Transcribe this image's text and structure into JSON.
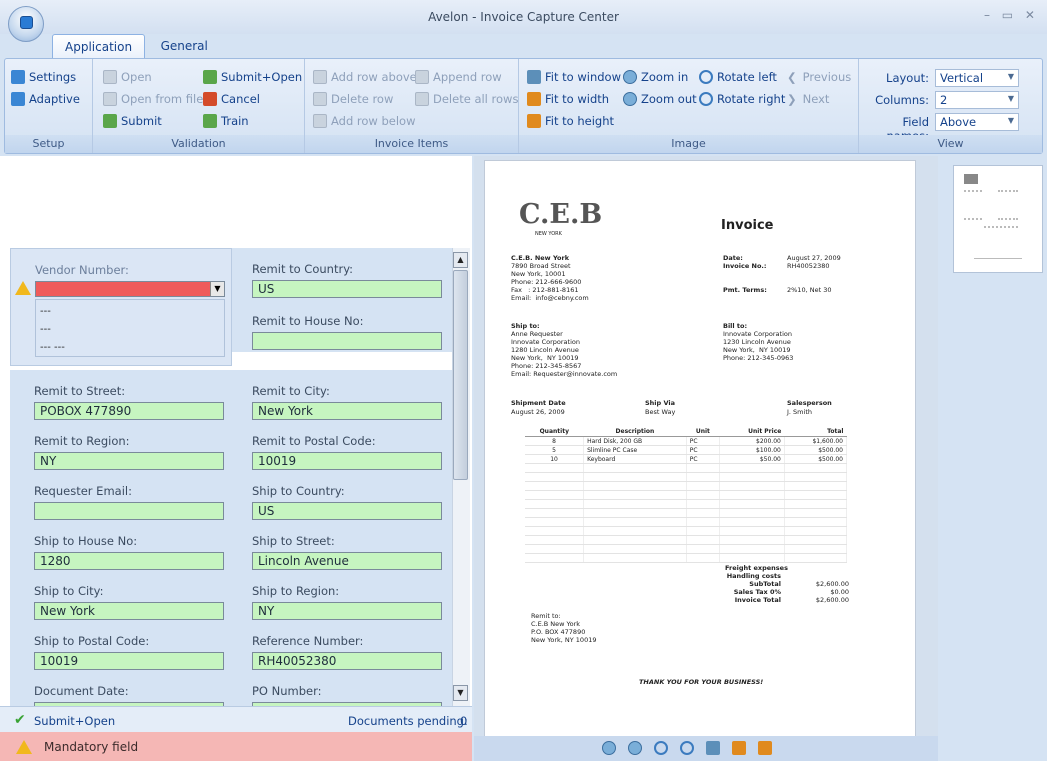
{
  "window": {
    "title": "Avelon - Invoice Capture Center",
    "controls": "– ▭ ✕"
  },
  "tabs": [
    {
      "label": "Application"
    },
    {
      "label": "General"
    }
  ],
  "ribbon": {
    "setup": {
      "label": "Setup",
      "items": [
        "Settings",
        "Adaptive"
      ]
    },
    "validation": {
      "label": "Validation",
      "items": [
        "Open",
        "Open from file",
        "Submit",
        "Submit+Open",
        "Cancel",
        "Train"
      ]
    },
    "invoice_items": {
      "label": "Invoice Items",
      "items": [
        "Add row above",
        "Delete row",
        "Add row below",
        "Append row",
        "Delete all rows"
      ]
    },
    "image": {
      "label": "Image",
      "items": [
        "Fit to window",
        "Fit to width",
        "Fit to height",
        "Zoom in",
        "Zoom out",
        "Rotate left",
        "Rotate right",
        "Previous",
        "Next"
      ]
    },
    "view": {
      "label": "View",
      "layout_label": "Layout:",
      "layout_value": "Vertical",
      "columns_label": "Columns:",
      "columns_value": "2",
      "fieldnames_label": "Field names:",
      "fieldnames_value": "Above"
    }
  },
  "vendor": {
    "label": "Vendor Number:",
    "options": [
      "---",
      "---",
      "--- ---"
    ]
  },
  "fields": [
    {
      "label": "Remit to Country:",
      "value": "US"
    },
    {
      "label": "Remit to House No:",
      "value": ""
    },
    {
      "label": "Remit to Street:",
      "value": "POBOX 477890"
    },
    {
      "label": "Remit to City:",
      "value": "New York"
    },
    {
      "label": "Remit to Region:",
      "value": "NY"
    },
    {
      "label": "Remit to Postal Code:",
      "value": "10019"
    },
    {
      "label": "Requester Email:",
      "value": ""
    },
    {
      "label": "Ship to Country:",
      "value": "US"
    },
    {
      "label": "Ship to House No:",
      "value": "1280"
    },
    {
      "label": "Ship to Street:",
      "value": "Lincoln Avenue"
    },
    {
      "label": "Ship to City:",
      "value": "New York"
    },
    {
      "label": "Ship to Region:",
      "value": "NY"
    },
    {
      "label": "Ship to Postal Code:",
      "value": "10019"
    },
    {
      "label": "Reference Number:",
      "value": "RH40052380"
    },
    {
      "label": "Document Date:",
      "value": "Aug 27, 2009"
    },
    {
      "label": "PO Number:",
      "value": ""
    }
  ],
  "status": {
    "submit_open": "Submit+Open",
    "pending_label": "Documents pending:",
    "pending_count": "0",
    "mandatory": "Mandatory field"
  },
  "invoice": {
    "logo": "C.E.B",
    "logo_sub": "NEW YORK",
    "heading": "Invoice",
    "company": [
      "C.E.B. New York",
      "7890 Broad Street",
      "New York, 10001",
      "Phone: 212-666-9600",
      "Fax   : 212-881-8161",
      "Email:  info@cebny.com"
    ],
    "meta_labels": [
      "Date:",
      "Invoice No.:",
      "",
      "",
      "Pmt. Terms:"
    ],
    "meta_values": [
      "August 27, 2009",
      "RH40052380",
      "",
      "",
      "2%10, Net 30"
    ],
    "ship_to": [
      "Ship to:",
      "Anne Requester",
      "Innovate Corporation",
      "1280 Lincoln Avenue",
      "New York,  NY 10019",
      "Phone: 212-345-8567",
      "Email: Requester@innovate.com"
    ],
    "bill_to": [
      "Bill to:",
      "Innovate Corporation",
      "1230 Lincoln Avenue",
      "New York,  NY 10019",
      "Phone: 212-345-0963"
    ],
    "ship_headers": [
      "Shipment Date",
      "Ship Via",
      "Salesperson"
    ],
    "ship_values": [
      "August 26, 2009",
      "Best Way",
      "J. Smith"
    ],
    "item_headers": [
      "Quantity",
      "Description",
      "Unit",
      "Unit Price",
      "Total"
    ],
    "items": [
      [
        "8",
        "Hard Disk, 200 GB",
        "PC",
        "$200.00",
        "$1,600.00"
      ],
      [
        "5",
        "Slimline PC Case",
        "PC",
        "$100.00",
        "$500.00"
      ],
      [
        "10",
        "Keyboard",
        "PC",
        "$50.00",
        "$500.00"
      ]
    ],
    "totals_labels": [
      "Freight expenses",
      "Handling costs",
      "SubTotal",
      "Sales Tax 0%",
      "Invoice Total"
    ],
    "totals_values": [
      "",
      "",
      "$2,600.00",
      "$0.00",
      "$2,600.00"
    ],
    "remit": [
      "Remit to:",
      "C.E.B New York",
      "P.O. BOX 477890",
      "New York, NY 10019"
    ],
    "thanks": "THANK YOU FOR YOUR BUSINESS!"
  },
  "colors": {
    "valid_field": "#c6f5c0",
    "error_field": "#ef5b5b",
    "mandatory_bar": "#f5b7b5"
  }
}
